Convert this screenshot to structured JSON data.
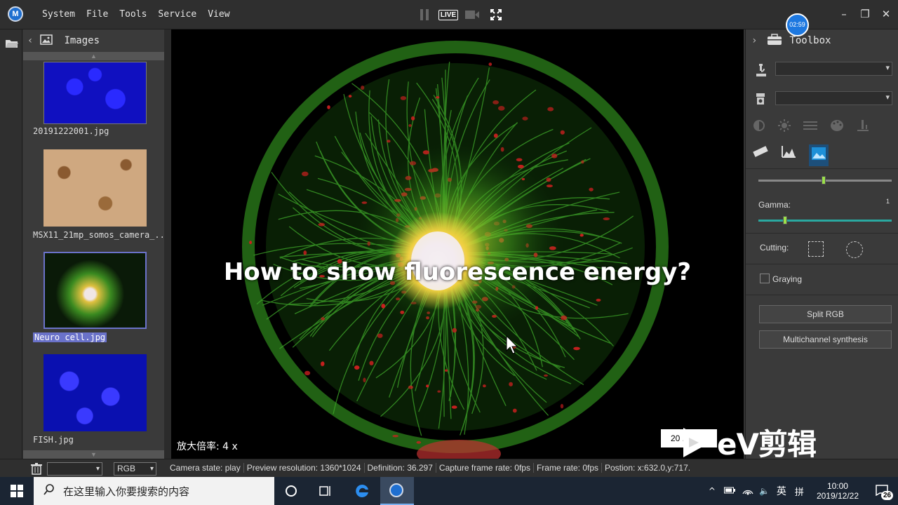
{
  "app": {
    "logo_letter": "M",
    "menu": [
      "System",
      "File",
      "Tools",
      "Service",
      "View"
    ],
    "live_label": "LIVE",
    "timer": "02:59",
    "window_controls": [
      "–",
      "❐",
      "✕"
    ]
  },
  "images_panel": {
    "title": "Images",
    "items": [
      {
        "name": "20191222001.jpg",
        "selected": false,
        "color": "#1a18d8"
      },
      {
        "name": "MSX11_21mp_somos_camera_..",
        "selected": false,
        "color": "#c79f78"
      },
      {
        "name": "Neuro cell.jpg",
        "selected": true,
        "color": "#0c2a0a"
      },
      {
        "name": "FISH.jpg",
        "selected": false,
        "color": "#1620c8"
      }
    ]
  },
  "viewer": {
    "overlay_text": "How to show fluorescence energy?",
    "magnification": "放大倍率: 4 x",
    "scale_label": "20 ..."
  },
  "toolbox": {
    "title": "Toolbox",
    "gamma_label": "Gamma:",
    "gamma_value": "1",
    "cutting_label": "Cutting:",
    "graying_label": "Graying",
    "split_rgb": "Split RGB",
    "multichannel": "Multichannel synthesis",
    "slider1": 0.49,
    "gamma_slider": 0.2
  },
  "statusbar": {
    "channel": "RGB",
    "items": [
      "Camera state:  play",
      "Preview resolution:  1360*1024",
      "Definition:  36.297",
      "Capture frame rate:  0fps",
      "Frame rate:  0fps",
      "Postion:    x:632.0,y:717."
    ]
  },
  "watermark": {
    "text": "eV剪辑"
  },
  "taskbar": {
    "search_placeholder": "在这里输入你要搜索的内容",
    "ime": "英",
    "time": "10:00",
    "date": "2019/12/22",
    "notify_count": "26"
  }
}
